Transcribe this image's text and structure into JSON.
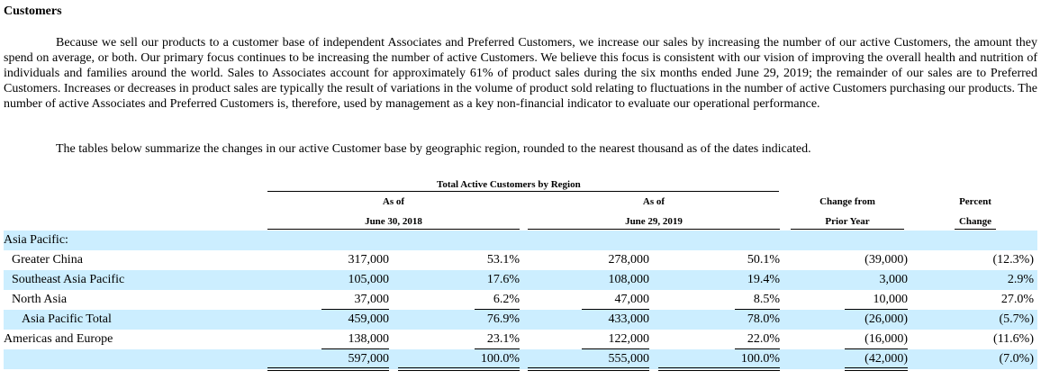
{
  "section_title": "Customers",
  "paragraph1": "Because we sell our products to a customer base of independent Associates and Preferred Customers, we increase our sales by increasing the number of our active Customers, the amount they spend on average, or both.  Our primary focus continues to be increasing the number of active Customers.  We believe this focus is consistent with our vision of improving the overall health and nutrition of individuals and families around the world.  Sales to Associates account for approximately 61% of product sales during the six months ended June 29, 2019; the remainder of our sales are to Preferred Customers.  Increases or decreases in product sales are typically the result of variations in the volume of product sold relating to fluctuations in the number of active Customers purchasing our products.  The number of active Associates and Preferred Customers is, therefore, used by management as a key non-financial indicator to evaluate our operational performance.",
  "paragraph2": "The tables below summarize the changes in our active Customer base by geographic region, rounded to the nearest thousand as of the dates indicated.",
  "table": {
    "caption": "Total Active Customers by Region",
    "col1_line1": "As of",
    "col1_line2": "June 30, 2018",
    "col2_line1": "As of",
    "col2_line2": "June 29, 2019",
    "col3_line1": "Change from",
    "col3_line2": "Prior Year",
    "col4_line1": "Percent",
    "col4_line2": "Change",
    "rows": [
      {
        "label": "Asia Pacific:",
        "c2018": "",
        "p2018": "",
        "c2019": "",
        "p2019": "",
        "change": "",
        "pct": ""
      },
      {
        "label": "Greater China",
        "c2018": "317,000",
        "p2018": "53.1%",
        "c2019": "278,000",
        "p2019": "50.1%",
        "change": "(39,000)",
        "pct": "(12.3%)"
      },
      {
        "label": "Southeast Asia Pacific",
        "c2018": "105,000",
        "p2018": "17.6%",
        "c2019": "108,000",
        "p2019": "19.4%",
        "change": "3,000",
        "pct": "2.9%"
      },
      {
        "label": "North Asia",
        "c2018": "37,000",
        "p2018": "6.2%",
        "c2019": "47,000",
        "p2019": "8.5%",
        "change": "10,000",
        "pct": "27.0%"
      },
      {
        "label": "Asia Pacific Total",
        "c2018": "459,000",
        "p2018": "76.9%",
        "c2019": "433,000",
        "p2019": "78.0%",
        "change": "(26,000)",
        "pct": "(5.7%)"
      },
      {
        "label": "Americas and Europe",
        "c2018": "138,000",
        "p2018": "23.1%",
        "c2019": "122,000",
        "p2019": "22.0%",
        "change": "(16,000)",
        "pct": "(11.6%)"
      },
      {
        "label": "",
        "c2018": "597,000",
        "p2018": "100.0%",
        "c2019": "555,000",
        "p2019": "100.0%",
        "change": "(42,000)",
        "pct": "(7.0%)"
      }
    ]
  }
}
